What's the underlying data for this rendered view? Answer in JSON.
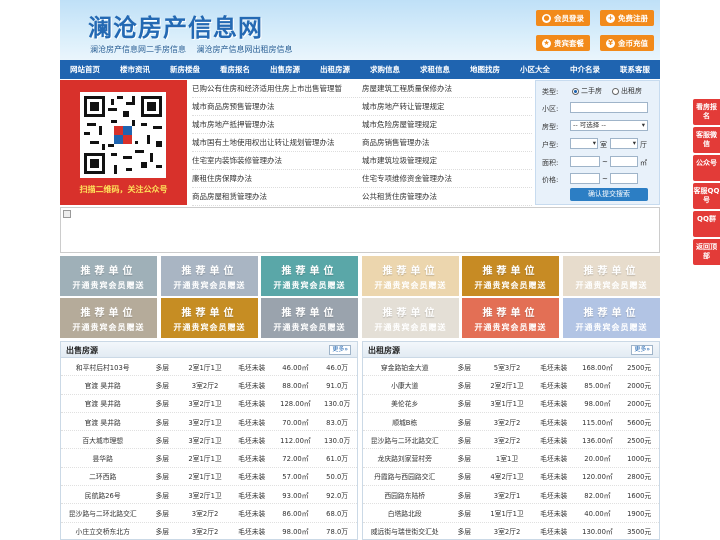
{
  "header": {
    "title": "澜沧房产信息网",
    "sub1": "澜沧房产信息网二手房信息",
    "sub2": "澜沧房产信息网出租房信息",
    "buttons": [
      {
        "label": "会员登录"
      },
      {
        "label": "免费注册"
      },
      {
        "label": "贵宾套餐"
      },
      {
        "label": "金币充值"
      }
    ]
  },
  "nav": [
    "网站首页",
    "楼市资讯",
    "新房楼盘",
    "看房报名",
    "出售房源",
    "出租房源",
    "求购信息",
    "求租信息",
    "地图找房",
    "小区大全",
    "中介名录",
    "联系客服"
  ],
  "qr": {
    "caption": "扫描二维码，关注公众号"
  },
  "news": [
    [
      "已购公有住房和经济适用住房上市出售管理暂",
      "房屋建筑工程质量保修办法"
    ],
    [
      "城市商品房预售管理办法",
      "城市房地产转让管理规定"
    ],
    [
      "城市房地产抵押管理办法",
      "城市危险房屋管理规定"
    ],
    [
      "城市国有土地使用权出让转让规划管理办法",
      "商品房销售管理办法"
    ],
    [
      "住宅室内装饰装修管理办法",
      "城市建筑垃圾管理规定"
    ],
    [
      "廉租住房保障办法",
      "住宅专项维修资金管理办法"
    ],
    [
      "商品房屋租赁管理办法",
      "公共租赁住房管理办法"
    ]
  ],
  "search": {
    "type_label": "类型:",
    "type_opt1": "二手房",
    "type_opt2": "出租房",
    "community_label": "小区:",
    "house_label": "房型:",
    "house_value": "-- 可选择 --",
    "layout_label": "户型:",
    "room_unit": "室",
    "hall_unit": "厅",
    "area_label": "面积:",
    "price_label": "价格:",
    "tilde": "~",
    "area_unit": "㎡",
    "submit": "确认提交搜索"
  },
  "ads": {
    "line1": "推荐单位",
    "line2": "开通贵宾会员赠送"
  },
  "sale": {
    "title": "出售房源",
    "more": "更多»",
    "rows": [
      [
        "和平村后村103号",
        "多层",
        "2室1厅1卫",
        "毛坯未装",
        "46.00㎡",
        "46.0万"
      ],
      [
        "官渡 昊井路",
        "多层",
        "3室2厅2",
        "毛坯未装",
        "88.00㎡",
        "91.0万"
      ],
      [
        "官渡 昊井路",
        "多层",
        "3室2厅1卫",
        "毛坯未装",
        "128.00㎡",
        "130.0万"
      ],
      [
        "官渡 昊井路",
        "多层",
        "3室2厅1卫",
        "毛坯未装",
        "70.00㎡",
        "83.0万"
      ],
      [
        "百大城市理想",
        "多层",
        "3室2厅1卫",
        "毛坯未装",
        "112.00㎡",
        "130.0万"
      ],
      [
        "昙华路",
        "多层",
        "2室1厅1卫",
        "毛坯未装",
        "72.00㎡",
        "61.0万"
      ],
      [
        "二环西路",
        "多层",
        "2室1厅1卫",
        "毛坯未装",
        "57.00㎡",
        "50.0万"
      ],
      [
        "民航路26号",
        "多层",
        "3室2厅1卫",
        "毛坯未装",
        "93.00㎡",
        "92.0万"
      ],
      [
        "昆沙路与二环北路交汇",
        "多层",
        "3室2厅2",
        "毛坯未装",
        "86.00㎡",
        "68.0万"
      ],
      [
        "小庄立交桥东北方",
        "多层",
        "3室2厅2",
        "毛坯未装",
        "98.00㎡",
        "78.0万"
      ]
    ]
  },
  "rent": {
    "title": "出租房源",
    "more": "更多»",
    "rows": [
      [
        "穿金路铂金大道",
        "多层",
        "5室3厅2",
        "毛坯未装",
        "168.00㎡",
        "2500元"
      ],
      [
        "小康大道",
        "多层",
        "2室2厅1卫",
        "毛坯未装",
        "85.00㎡",
        "2000元"
      ],
      [
        "美伦花乡",
        "多层",
        "3室1厅1卫",
        "毛坯未装",
        "98.00㎡",
        "2000元"
      ],
      [
        "顺城B栋",
        "多层",
        "3室2厅2",
        "毛坯未装",
        "115.00㎡",
        "5600元"
      ],
      [
        "昆沙路与二环北路交汇",
        "多层",
        "3室2厅2",
        "毛坯未装",
        "136.00㎡",
        "2500元"
      ],
      [
        "龙庆路刘家营村旁",
        "多层",
        "1室1卫",
        "毛坯未装",
        "20.00㎡",
        "1000元"
      ],
      [
        "丹霞路与西园路交汇",
        "多层",
        "4室2厅1卫",
        "毛坯未装",
        "120.00㎡",
        "2800元"
      ],
      [
        "西园路东陆桥",
        "多层",
        "3室2厅1",
        "毛坯未装",
        "82.00㎡",
        "1600元"
      ],
      [
        "白塔路北段",
        "多层",
        "1室1厅1卫",
        "毛坯未装",
        "40.00㎡",
        "1900元"
      ],
      [
        "威远街与瑞世街交汇处",
        "多层",
        "3室2厅2",
        "毛坯未装",
        "130.00㎡",
        "3500元"
      ]
    ]
  },
  "side": [
    "看房报名",
    "客服微信",
    "公众号",
    "客服QQ号",
    "QQ群",
    "返回顶部"
  ],
  "colors": {
    "nav": "#1f64b0",
    "accent": "#f28a1a",
    "qr_bg": "#d8312b",
    "side": "#e33b38"
  }
}
